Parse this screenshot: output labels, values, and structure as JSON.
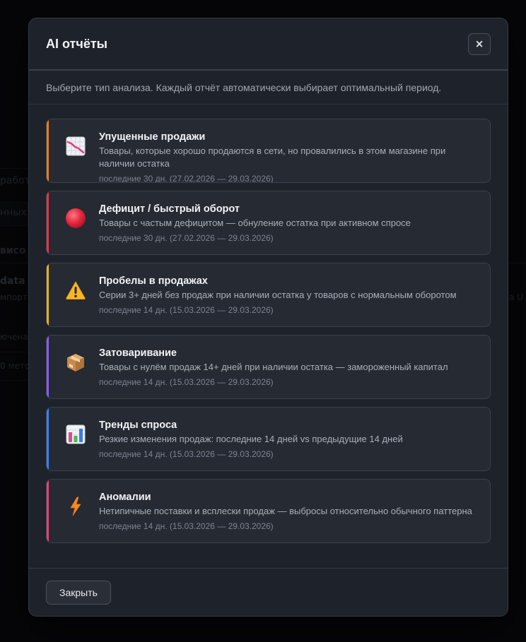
{
  "background": {
    "fragments": [
      "работ",
      "нных",
      "висо",
      "data",
      "мпорт",
      "ючена",
      "0 мето",
      "а U"
    ]
  },
  "modal": {
    "title": "AI отчёты",
    "close_label": "×",
    "subtitle": "Выберите тип анализа. Каждый отчёт автоматически выбирает оптимальный период.",
    "cards": [
      {
        "icon": "chart-decreasing-icon",
        "accent": "#f07a1f",
        "title": "Упущенные продажи",
        "description": "Товары, которые хорошо продаются в сети, но провалились в этом магазине при наличии остатка",
        "period": "последние 30 дн. (27.02.2026 — 29.03.2026)"
      },
      {
        "icon": "red-circle-icon",
        "accent": "#e2364a",
        "title": "Дефицит / быстрый оборот",
        "description": "Товары с частым дефицитом — обнуление остатка при активном спросе",
        "period": "последние 30 дн. (27.02.2026 — 29.03.2026)"
      },
      {
        "icon": "warning-icon",
        "accent": "#e8b215",
        "title": "Пробелы в продажах",
        "description": "Серии 3+ дней без продаж при наличии остатка у товаров с нормальным оборотом",
        "period": "последние 14 дн. (15.03.2026 — 29.03.2026)"
      },
      {
        "icon": "package-icon",
        "accent": "#8a5cf0",
        "title": "Затоваривание",
        "description": "Товары с нулём продаж 14+ дней при наличии остатка — замороженный капитал",
        "period": "последние 14 дн. (15.03.2026 — 29.03.2026)"
      },
      {
        "icon": "bar-chart-icon",
        "accent": "#3a82f0",
        "title": "Тренды спроса",
        "description": "Резкие изменения продаж: последние 14 дней vs предыдущие 14 дней",
        "period": "последние 14 дн. (15.03.2026 — 29.03.2026)"
      },
      {
        "icon": "lightning-icon",
        "accent": "#e8417a",
        "title": "Аномалии",
        "description": "Нетипичные поставки и всплески продаж — выбросы относительно обычного паттерна",
        "period": "последние 14 дн. (15.03.2026 — 29.03.2026)"
      }
    ],
    "footer_button": "Закрыть"
  }
}
